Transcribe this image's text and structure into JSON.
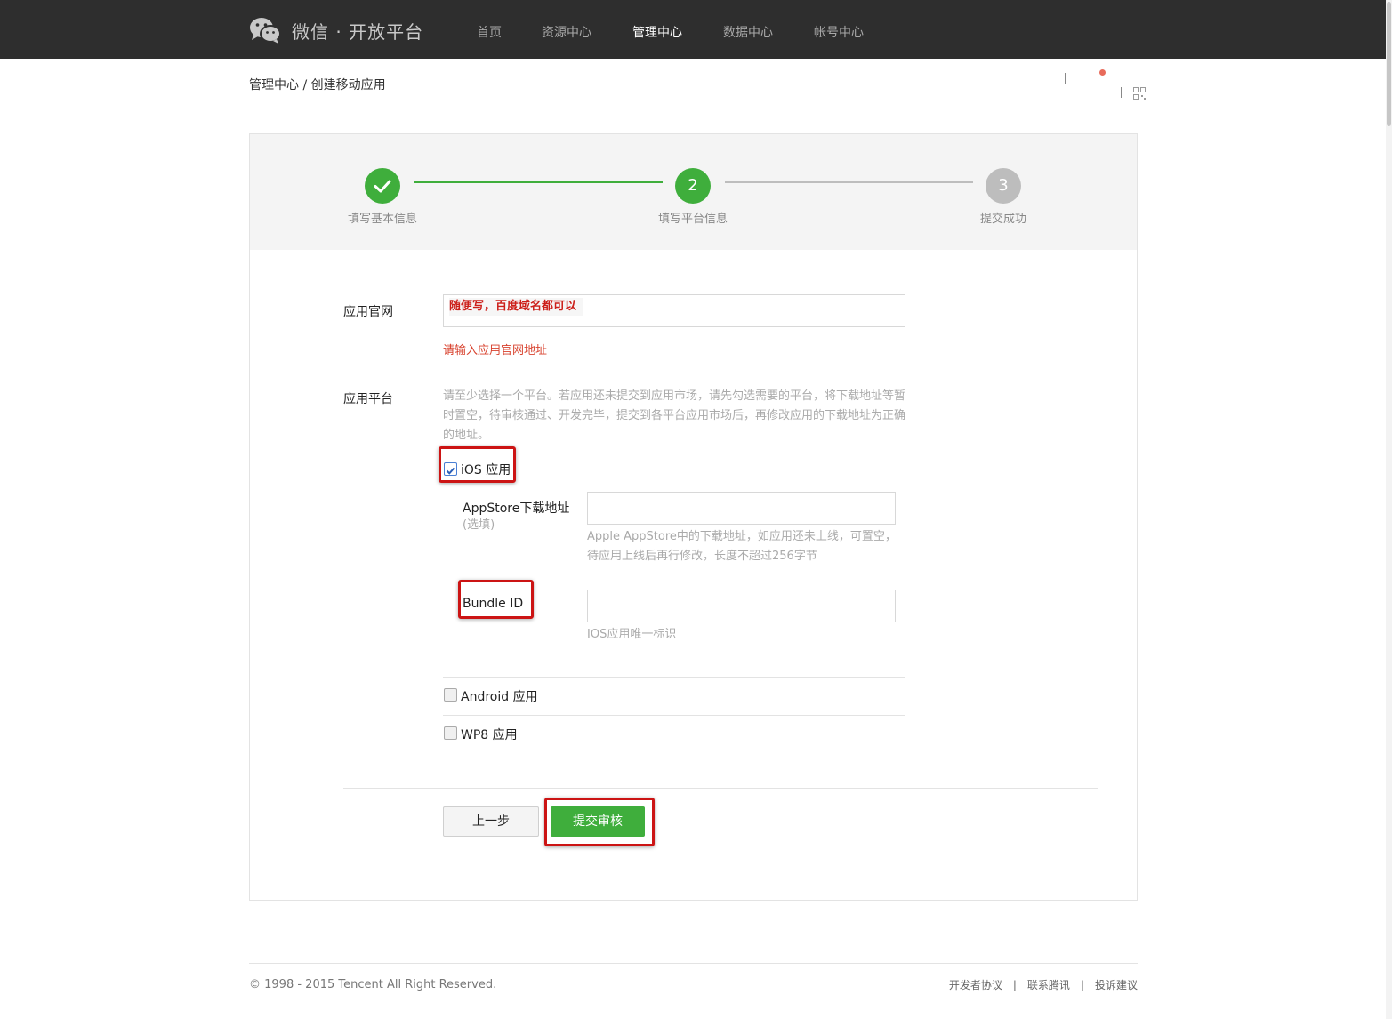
{
  "header": {
    "logo_text": "微信 · 开放平台",
    "nav": [
      {
        "label": "首页",
        "active": false
      },
      {
        "label": "资源中心",
        "active": false
      },
      {
        "label": "管理中心",
        "active": true
      },
      {
        "label": "数据中心",
        "active": false
      },
      {
        "label": "帐号中心",
        "active": false
      }
    ]
  },
  "breadcrumb": "管理中心 / 创建移动应用",
  "steps": [
    {
      "number": "",
      "label": "填写基本信息",
      "state": "done"
    },
    {
      "number": "2",
      "label": "填写平台信息",
      "state": "current"
    },
    {
      "number": "3",
      "label": "提交成功",
      "state": "pending"
    }
  ],
  "form": {
    "website": {
      "label": "应用官网",
      "value": "",
      "annotation": "随便写，百度域名都可以",
      "error": "请输入应用官网地址"
    },
    "platform": {
      "label": "应用平台",
      "hint": "请至少选择一个平台。若应用还未提交到应用市场，请先勾选需要的平台，将下载地址等暂时置空，待审核通过、开发完毕，提交到各平台应用市场后，再修改应用的下载地址为正确的地址。",
      "ios": {
        "label": "iOS 应用",
        "checked": true,
        "appstore_label": "AppStore下载地址",
        "appstore_optional": "(选填)",
        "appstore_value": "",
        "appstore_hint": "Apple AppStore中的下载地址，如应用还未上线，可置空，待应用上线后再行修改，长度不超过256字节",
        "bundle_label": "Bundle ID",
        "bundle_value": "",
        "bundle_hint": "IOS应用唯一标识"
      },
      "android": {
        "label": "Android 应用",
        "checked": false
      },
      "wp8": {
        "label": "WP8 应用",
        "checked": false
      }
    }
  },
  "buttons": {
    "prev": "上一步",
    "submit": "提交审核"
  },
  "footer": {
    "copyright": "© 1998 - 2015 Tencent All Right Reserved.",
    "links": [
      "开发者协议",
      "联系腾讯",
      "投诉建议"
    ]
  },
  "colors": {
    "topbar": "#2e2e2e",
    "green": "#3fae3c",
    "step_pending": "#bdbdbd",
    "error": "#d8432f",
    "annotation": "#cc1414"
  }
}
